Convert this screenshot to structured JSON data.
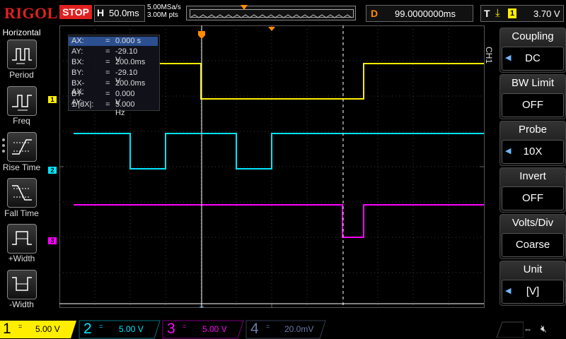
{
  "header": {
    "logo": "RIGOL",
    "run_status": "STOP",
    "timebase_letter": "H",
    "timebase_scale": "50.0ms",
    "sample_rate": "5.00MSa/s",
    "memory_depth": "3.00M pts",
    "delay_letter": "D",
    "delay_value": "99.0000000ms",
    "trigger_letter": "T",
    "trigger_source": "1",
    "trigger_level": "3.70 V"
  },
  "left_menu": {
    "title": "Horizontal",
    "items": [
      {
        "label": "Period",
        "icon": "period-icon"
      },
      {
        "label": "Freq",
        "icon": "frequency-icon"
      },
      {
        "label": "Rise Time",
        "icon": "rise-time-icon"
      },
      {
        "label": "Fall Time",
        "icon": "fall-time-icon"
      },
      {
        "label": "+Width",
        "icon": "positive-width-icon"
      },
      {
        "label": "-Width",
        "icon": "negative-width-icon"
      }
    ]
  },
  "cursor_readout": {
    "rows": [
      {
        "key": "AX:",
        "eq": "=",
        "val": "0.000 s"
      },
      {
        "key": "AY:",
        "eq": "=",
        "val": "-29.10 V"
      },
      {
        "key": "BX:",
        "eq": "=",
        "val": "200.0ms"
      },
      {
        "key": "BY:",
        "eq": "=",
        "val": "-29.10 V"
      },
      {
        "key": "BX-AX:",
        "eq": "=",
        "val": "200.0ms"
      },
      {
        "key": "BY-AY:",
        "eq": "=",
        "val": "0.000 V"
      },
      {
        "key": "1/|dX|:",
        "eq": "=",
        "val": "5.000 Hz"
      }
    ]
  },
  "channel_markers": [
    "1",
    "2",
    "3"
  ],
  "right_menu": {
    "channel_tab": "CH1",
    "items": [
      {
        "title": "Coupling",
        "value": "DC",
        "has_arrow": true
      },
      {
        "title": "BW Limit",
        "value": "OFF",
        "has_arrow": false
      },
      {
        "title": "Probe",
        "value": "10X",
        "has_arrow": true
      },
      {
        "title": "Invert",
        "value": "OFF",
        "has_arrow": false
      },
      {
        "title": "Volts/Div",
        "value": "Coarse",
        "has_arrow": false
      },
      {
        "title": "Unit",
        "value": "[V]",
        "has_arrow": true
      }
    ]
  },
  "channels": [
    {
      "number": "1",
      "coupling": "=",
      "scale": "5.00 V",
      "color": "#ffee00",
      "active": true
    },
    {
      "number": "2",
      "coupling": "=",
      "scale": "5.00 V",
      "color": "#00e5ff",
      "active": false
    },
    {
      "number": "3",
      "coupling": "=",
      "scale": "5.00 V",
      "color": "#ff00ff",
      "active": false
    },
    {
      "number": "4",
      "coupling": "=",
      "scale": "20.0mV",
      "color": "#6a7aa8",
      "active": false
    }
  ],
  "colors": {
    "ch1": "#ffee00",
    "ch2": "#00e5ff",
    "ch3": "#ff00ff",
    "accent_red": "#e02020",
    "trigger_orange": "#ff8c00"
  }
}
